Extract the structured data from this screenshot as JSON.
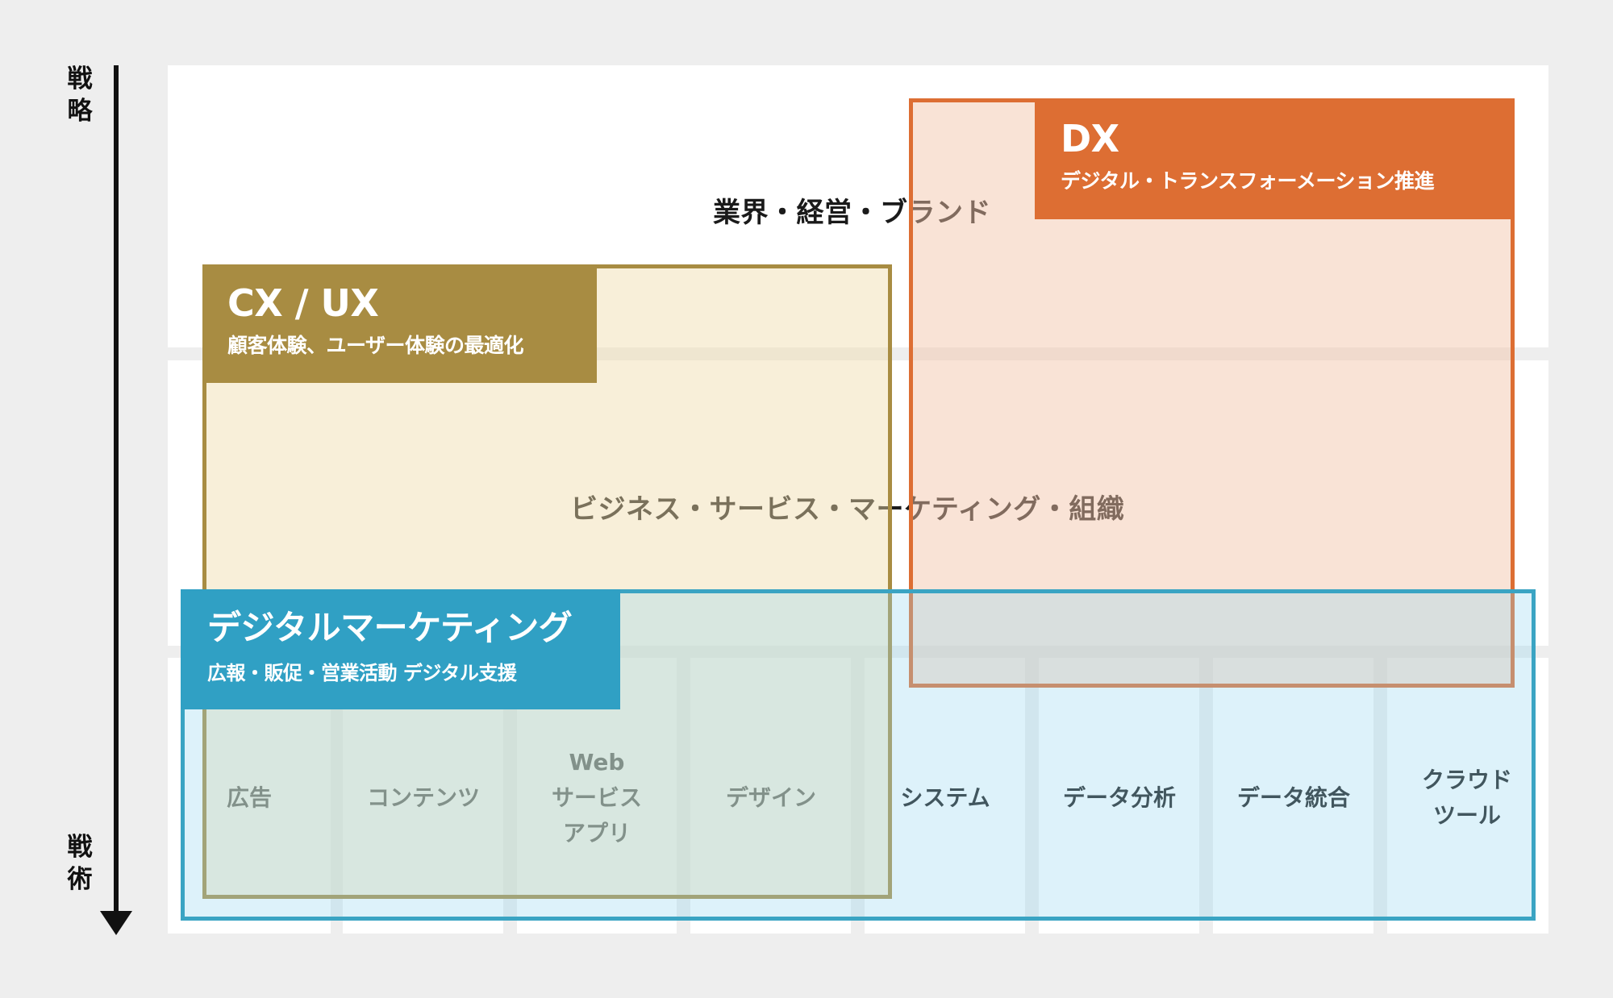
{
  "axis": {
    "top_label": "戦\n略",
    "bottom_label": "戦\n術"
  },
  "rows": {
    "top": "業界・経営・ブランド",
    "middle": "ビジネス・サービス・マーケティング・組織"
  },
  "boxes": {
    "cx": {
      "title": "CX / UX",
      "subtitle": "顧客体験、ユーザー体験の最適化",
      "color": "#a88c42"
    },
    "dx": {
      "title": "DX",
      "subtitle": "デジタル・トランスフォーメーション推進",
      "color": "#dd6e33"
    },
    "dm": {
      "title": "デジタルマーケティング",
      "subtitle": "広報・販促・営業活動 デジタル支援",
      "color": "#30a0c4"
    }
  },
  "columns": [
    "広告",
    "コンテンツ",
    "Web\nサービス\nアプリ",
    "デザイン",
    "システム",
    "データ分析",
    "データ統合",
    "クラウド\nツール"
  ]
}
